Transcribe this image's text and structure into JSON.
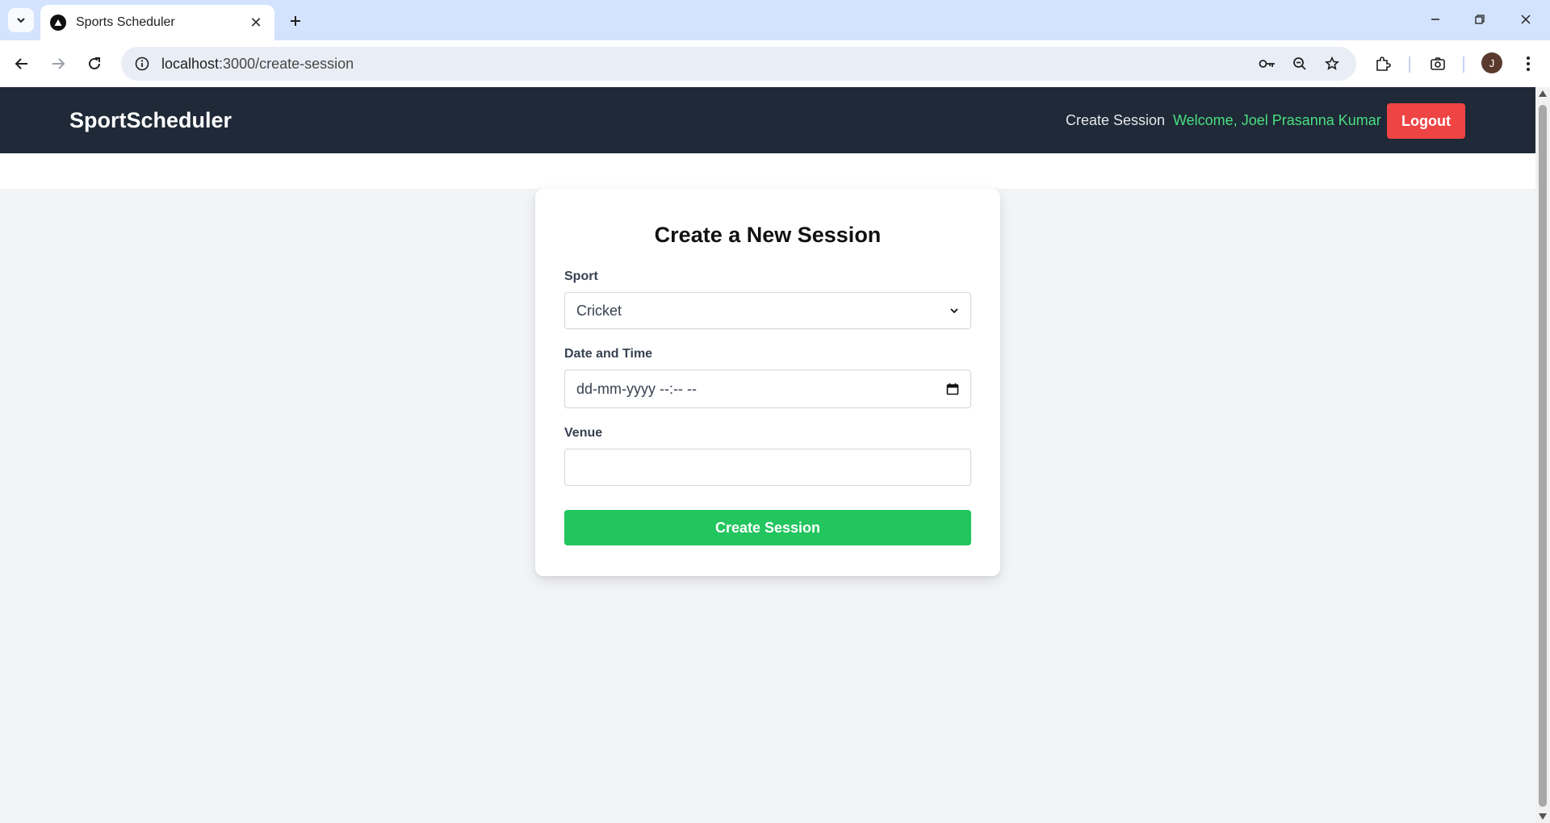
{
  "browser": {
    "tab_title": "Sports Scheduler",
    "url_host": "localhost",
    "url_rest": ":3000/create-session",
    "avatar_initial": "J"
  },
  "app": {
    "brand": "SportScheduler",
    "nav_create_session": "Create Session",
    "welcome_text": "Welcome, Joel Prasanna Kumar",
    "logout_label": "Logout",
    "colors": {
      "navbar_bg": "#1f2937",
      "welcome_green": "#4ade80",
      "logout_red": "#ef4444",
      "submit_green": "#22c55e"
    }
  },
  "form": {
    "title": "Create a New Session",
    "sport_label": "Sport",
    "sport_value": "Cricket",
    "datetime_label": "Date and Time",
    "datetime_placeholder": "dd-mm-yyyy --:-- --",
    "venue_label": "Venue",
    "venue_value": "",
    "submit_label": "Create Session"
  }
}
